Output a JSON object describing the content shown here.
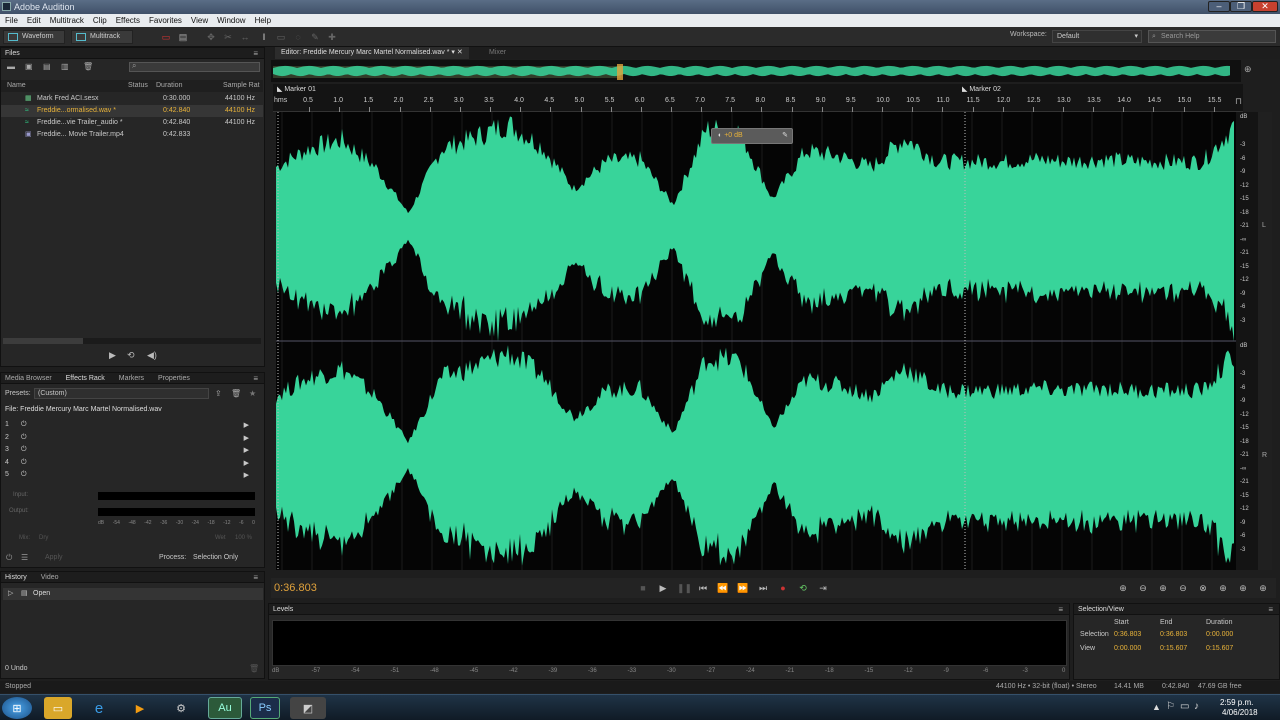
{
  "app": {
    "title": "Adobe Audition"
  },
  "menu": [
    "File",
    "Edit",
    "Multitrack",
    "Clip",
    "Effects",
    "Favorites",
    "View",
    "Window",
    "Help"
  ],
  "toolbar": {
    "waveform_label": "Waveform",
    "multitrack_label": "Multitrack",
    "workspace_label": "Workspace:",
    "workspace_value": "Default",
    "search_placeholder": "Search Help"
  },
  "files": {
    "tab": "Files",
    "columns": [
      "Name",
      "Status",
      "Duration",
      "Sample Rat"
    ],
    "rows": [
      {
        "name": "Mark Fred ACI.sesx",
        "status": "",
        "duration": "0:30.000",
        "rate": "44100 Hz"
      },
      {
        "name": "Freddie...ormalised.wav *",
        "status": "",
        "duration": "0:42.840",
        "rate": "44100 Hz"
      },
      {
        "name": "Freddie...vie Trailer_audio *",
        "status": "",
        "duration": "0:42.840",
        "rate": "44100 Hz"
      },
      {
        "name": "Freddie... Movie Trailer.mp4",
        "status": "",
        "duration": "0:42.833",
        "rate": ""
      }
    ]
  },
  "effects": {
    "tabs": [
      "Media Browser",
      "Effects Rack",
      "Markers",
      "Properties"
    ],
    "presets_label": "Presets:",
    "presets_value": "(Custom)",
    "file_label": "File: Freddie Mercury Marc Martel Normalised.wav",
    "slots": [
      "1",
      "2",
      "3",
      "4",
      "5"
    ],
    "input_label": "Input:",
    "output_label": "Output:",
    "meter_ticks": [
      "dB",
      "-54",
      "-48",
      "-42",
      "-36",
      "-30",
      "-24",
      "-18",
      "-12",
      "-6",
      "0"
    ],
    "mix_label": "Mix:",
    "dry_label": "Dry",
    "wet_label": "Wet",
    "wet_value": "100 %",
    "apply_label": "Apply",
    "process_label": "Process:",
    "process_value": "Selection Only"
  },
  "history": {
    "tabs": [
      "History",
      "Video"
    ],
    "items": [
      "Open"
    ],
    "undo_count": "0 Undo"
  },
  "editor": {
    "tab_label": "Editor: Freddie Mercury Marc Martel Normalised.wav *",
    "mixer_label": "Mixer",
    "markers": [
      "Marker 01",
      "Marker 02"
    ],
    "ruler_unit": "hms",
    "ruler_ticks": [
      "0.5",
      "1.0",
      "1.5",
      "2.0",
      "2.5",
      "3.0",
      "3.5",
      "4.0",
      "4.5",
      "5.0",
      "5.5",
      "6.0",
      "6.5",
      "7.0",
      "7.5",
      "8.0",
      "8.5",
      "9.0",
      "9.5",
      "10.0",
      "10.5",
      "11.0",
      "11.5",
      "12.0",
      "12.5",
      "13.0",
      "13.5",
      "14.0",
      "14.5",
      "15.0",
      "15.5"
    ],
    "hud_value": "+0 dB",
    "db_unit": "dB",
    "db_ticks": [
      "-3",
      "-6",
      "-9",
      "-12",
      "-15",
      "-18",
      "-21",
      "-∞",
      "-21",
      "-15",
      "-12",
      "-9",
      "-6",
      "-3"
    ],
    "channel_labels": [
      "L",
      "R"
    ]
  },
  "transport": {
    "timecode": "0:36.803"
  },
  "levels": {
    "tab": "Levels",
    "ticks": [
      "dB",
      "-57",
      "-54",
      "-51",
      "-48",
      "-45",
      "-42",
      "-39",
      "-36",
      "-33",
      "-30",
      "-27",
      "-24",
      "-21",
      "-18",
      "-15",
      "-12",
      "-9",
      "-6",
      "-3",
      "0"
    ]
  },
  "selection_view": {
    "tab": "Selection/View",
    "headers": [
      "Start",
      "End",
      "Duration"
    ],
    "selection": {
      "label": "Selection",
      "start": "0:36.803",
      "end": "0:36.803",
      "duration": "0:00.000"
    },
    "view": {
      "label": "View",
      "start": "0:00.000",
      "end": "0:15.607",
      "duration": "0:15.607"
    }
  },
  "status": {
    "left": "Stopped",
    "format": "44100 Hz • 32-bit (float) • Stereo",
    "size": "14.41 MB",
    "duration": "0:42.840",
    "free": "47.69 GB free"
  },
  "taskbar": {
    "time": "2:59 p.m.",
    "date": "4/06/2018"
  },
  "chart_data": {
    "type": "area",
    "title": "",
    "xlabel": "",
    "ylabel": "",
    "xlim": [
      0,
      15.6
    ],
    "series": [
      {
        "values": [
          0.55,
          0.72,
          0.8,
          0.55,
          0.12,
          0.72,
          0.82,
          0.95,
          0.75,
          0.35,
          0.6,
          0.62,
          0.2,
          0.9,
          0.88,
          0.25,
          0.7,
          0.65,
          0.55,
          0.82,
          0.6,
          0.6,
          0.6,
          0.62,
          0.6,
          0.62,
          0.6,
          0.6,
          0.6,
          0.95
        ]
      },
      {
        "values": [
          0.55,
          0.72,
          0.8,
          0.55,
          0.12,
          0.72,
          0.82,
          0.95,
          0.75,
          0.35,
          0.6,
          0.62,
          0.2,
          0.9,
          0.88,
          0.25,
          0.7,
          0.65,
          0.55,
          0.82,
          0.6,
          0.6,
          0.6,
          0.62,
          0.6,
          0.62,
          0.6,
          0.6,
          0.6,
          0.95
        ]
      }
    ]
  }
}
